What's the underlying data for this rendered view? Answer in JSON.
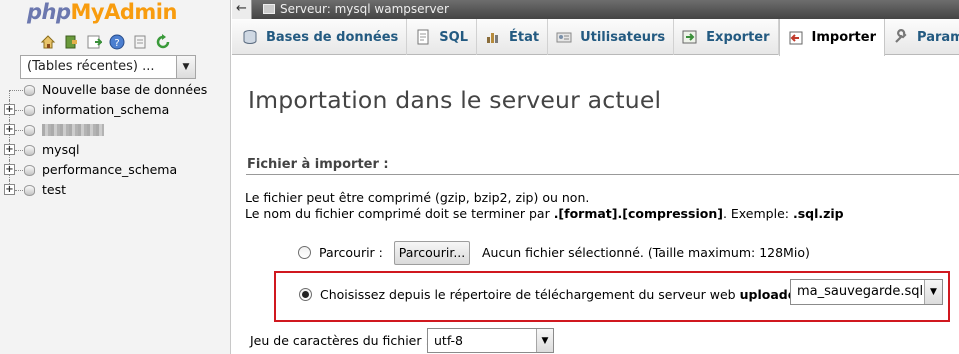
{
  "logo": {
    "php": "php",
    "my": "My",
    "admin": "Admin"
  },
  "quick_icons": [
    "home-icon",
    "logout-icon",
    "query-window-icon",
    "help-icon",
    "docs-icon",
    "reload-icon"
  ],
  "recent_select": {
    "value": "(Tables récentes) ..."
  },
  "tree": {
    "new_db": "Nouvelle base de données",
    "items": [
      "information_schema",
      "",
      "mysql",
      "performance_schema",
      "test"
    ]
  },
  "topbar": {
    "back": "←",
    "title": "Serveur: mysql wampserver"
  },
  "tabs": [
    {
      "label": "Bases de données",
      "icon": "database-icon"
    },
    {
      "label": "SQL",
      "icon": "sql-icon"
    },
    {
      "label": "État",
      "icon": "status-icon"
    },
    {
      "label": "Utilisateurs",
      "icon": "users-icon"
    },
    {
      "label": "Exporter",
      "icon": "export-icon"
    },
    {
      "label": "Importer",
      "icon": "import-icon"
    },
    {
      "label": "Paramèt",
      "icon": "wrench-icon"
    }
  ],
  "main": {
    "heading": "Importation dans le serveur actuel",
    "section_title": "Fichier à importer :",
    "note1": "Le fichier peut être comprimé (gzip, bzip2, zip) ou non.",
    "note2_pre": "Le nom du fichier comprimé doit se terminer par ",
    "note2_bold1": ".[format].[compression]",
    "note2_mid": ". Exemple: ",
    "note2_bold2": ".sql.zip",
    "browse_label": "Parcourir :",
    "browse_button": "Parcourir...",
    "no_file": "Aucun fichier sélectionné.  (Taille maximum: 128Mio)",
    "upload_label_pre": "Choisissez depuis le répertoire de téléchargement du serveur web ",
    "upload_label_bold": "uploaddir/",
    "upload_label_post": " :",
    "upload_file": "ma_sauvegarde.sql",
    "charset_label": "Jeu de caractères du fichier :",
    "charset_value": "utf-8"
  },
  "colors": {
    "accent_red": "#d0181f",
    "link_blue": "#235a81",
    "logo_orange": "#f89c0e",
    "logo_php": "#6c78af"
  }
}
